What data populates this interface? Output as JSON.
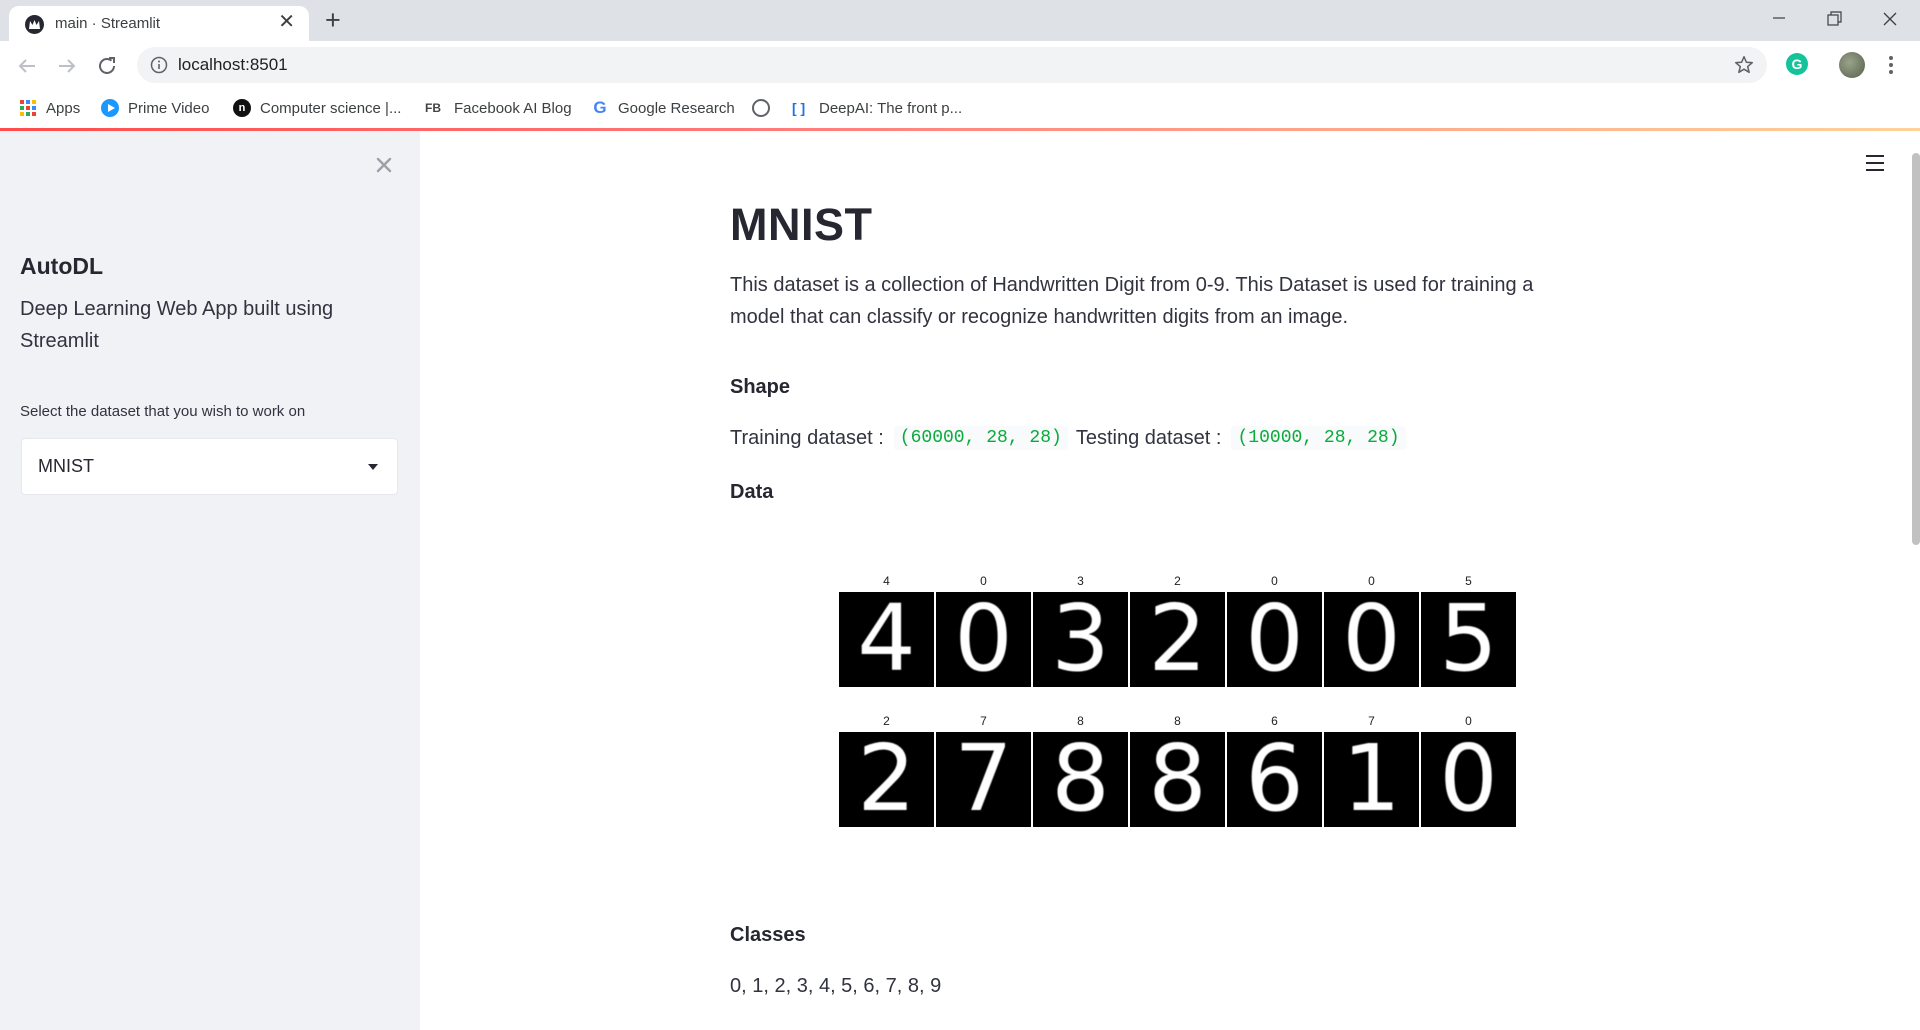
{
  "browser": {
    "tab_title": "main · Streamlit",
    "url": "localhost:8501",
    "bookmarks": [
      {
        "label": "Apps",
        "icon": "apps-grid-icon"
      },
      {
        "label": "Prime Video",
        "icon": "prime-video-icon"
      },
      {
        "label": "Computer science |...",
        "icon": "computer-science-icon"
      },
      {
        "label": "Facebook AI Blog",
        "icon": "facebook-ai-icon"
      },
      {
        "label": "Google Research",
        "icon": "google-icon"
      },
      {
        "label": "",
        "icon": "globe-icon"
      },
      {
        "label": "DeepAI: The front p...",
        "icon": "deepai-icon"
      }
    ]
  },
  "sidebar": {
    "title": "AutoDL",
    "description": "Deep Learning Web App built using Streamlit",
    "select_label": "Select the dataset that you wish to work on",
    "select_value": "MNIST"
  },
  "main": {
    "title": "MNIST",
    "description": "This dataset is a collection of Handwritten Digit from 0-9. This Dataset is used for training a model that can classify or recognize handwritten digits from an image.",
    "shape_heading": "Shape",
    "training_label": "Training dataset :",
    "training_shape": "(60000, 28, 28)",
    "testing_label": "Testing dataset :",
    "testing_shape": "(10000, 28, 28)",
    "data_heading": "Data",
    "samples": {
      "row1_labels": [
        "4",
        "0",
        "3",
        "2",
        "0",
        "0",
        "5"
      ],
      "row2_labels": [
        "2",
        "7",
        "8",
        "8",
        "6",
        "7",
        "0"
      ],
      "row1_digits": [
        "4",
        "0",
        "3",
        "2",
        "0",
        "0",
        "5"
      ],
      "row2_digits": [
        "2",
        "7",
        "8",
        "8",
        "6",
        "1",
        "0"
      ]
    },
    "classes_heading": "Classes",
    "classes": "0, 1, 2, 3, 4, 5, 6, 7, 8, 9"
  },
  "colors": {
    "accent": "#ff4b4b",
    "sidebar_bg": "#f0f2f6",
    "code_text": "#09ab3b",
    "text": "#262730"
  }
}
